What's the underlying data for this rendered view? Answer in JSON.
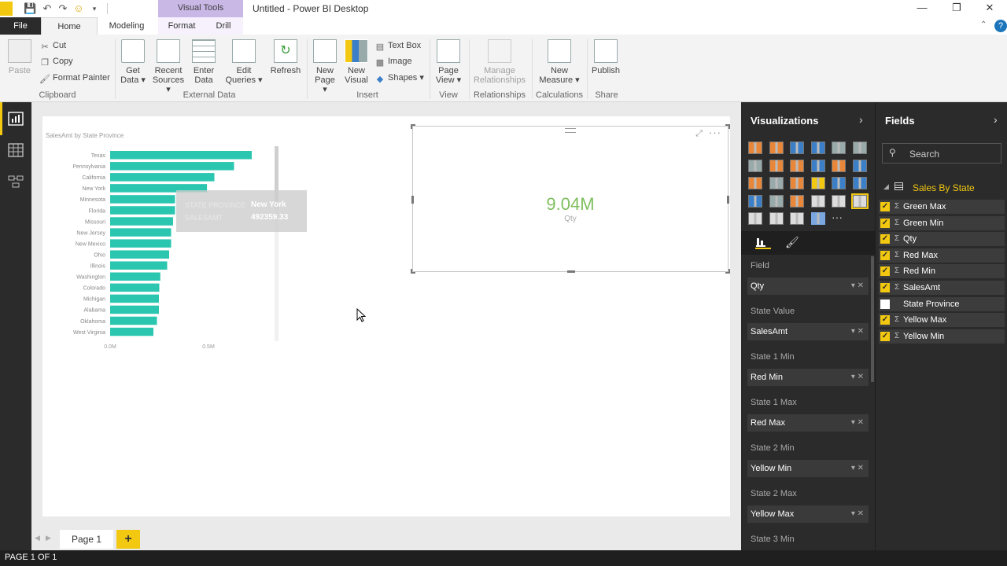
{
  "window": {
    "title": "Untitled - Power BI Desktop",
    "context_tab": "Visual Tools"
  },
  "tabs": [
    "File",
    "Home",
    "Modeling",
    "Format",
    "Drill"
  ],
  "ribbon": {
    "clipboard": {
      "paste": "Paste",
      "cut": "Cut",
      "copy": "Copy",
      "format_painter": "Format Painter",
      "label": "Clipboard"
    },
    "external_data": {
      "get_data": [
        "Get",
        "Data ▾"
      ],
      "recent_sources": [
        "Recent",
        "Sources ▾"
      ],
      "enter_data": [
        "Enter",
        "Data"
      ],
      "edit_queries": [
        "Edit",
        "Queries ▾"
      ],
      "refresh": "Refresh",
      "label": "External Data"
    },
    "insert": {
      "new_page": [
        "New",
        "Page ▾"
      ],
      "new_visual": [
        "New",
        "Visual"
      ],
      "text_box": "Text Box",
      "image": "Image",
      "shapes": "Shapes ▾",
      "label": "Insert"
    },
    "view": {
      "page_view": [
        "Page",
        "View ▾"
      ],
      "label": "View"
    },
    "relationships": {
      "manage": [
        "Manage",
        "Relationships"
      ],
      "label": "Relationships"
    },
    "calculations": {
      "new_measure": [
        "New",
        "Measure ▾"
      ],
      "label": "Calculations"
    },
    "share": {
      "publish": "Publish",
      "label": "Share"
    }
  },
  "report": {
    "bar_title": "SalesAmt by State Province",
    "card_value": "9.04M",
    "card_label": "Qty",
    "tooltip": {
      "k1": "STATE PROVINCE",
      "v1": "New York",
      "k2": "SALESAMT",
      "v2": "492359.33"
    }
  },
  "chart_data": {
    "type": "bar",
    "orientation": "horizontal",
    "title": "SalesAmt by State Province",
    "categories": [
      "Texas",
      "Pennsylvania",
      "California",
      "New York",
      "Minnesota",
      "Florida",
      "Missouri",
      "New Jersey",
      "New Mexico",
      "Ohio",
      "Illinois",
      "Washington",
      "Colorado",
      "Michigan",
      "Alabama",
      "Oklahoma",
      "West Virginia"
    ],
    "values": [
      720000,
      630000,
      530000,
      492359.33,
      330000,
      330000,
      320000,
      310000,
      310000,
      300000,
      290000,
      255000,
      250000,
      248000,
      248000,
      238000,
      220000
    ],
    "x_ticks": [
      "0.0M",
      "0.5M"
    ],
    "xlim": [
      0,
      1000000
    ],
    "color": "#2bc6b0"
  },
  "pages": {
    "tab": "Page 1",
    "add": "+"
  },
  "status": "PAGE 1 OF 1",
  "visualizations": {
    "title": "Visualizations",
    "wells": [
      {
        "label": "Field",
        "value": "Qty"
      },
      {
        "label": "State Value",
        "value": "SalesAmt"
      },
      {
        "label": "State 1 Min",
        "value": "Red Min"
      },
      {
        "label": "State 1 Max",
        "value": "Red Max"
      },
      {
        "label": "State 2 Min",
        "value": "Yellow Min"
      },
      {
        "label": "State 2 Max",
        "value": "Yellow Max"
      },
      {
        "label": "State 3 Min",
        "value": ""
      }
    ]
  },
  "fields": {
    "title": "Fields",
    "search_placeholder": "Search",
    "table": "Sales By State",
    "items": [
      {
        "name": "Green Max",
        "checked": true,
        "sigma": true
      },
      {
        "name": "Green Min",
        "checked": true,
        "sigma": true
      },
      {
        "name": "Qty",
        "checked": true,
        "sigma": true
      },
      {
        "name": "Red Max",
        "checked": true,
        "sigma": true
      },
      {
        "name": "Red Min",
        "checked": true,
        "sigma": true
      },
      {
        "name": "SalesAmt",
        "checked": true,
        "sigma": true
      },
      {
        "name": "State Province",
        "checked": false,
        "sigma": false
      },
      {
        "name": "Yellow Max",
        "checked": true,
        "sigma": true
      },
      {
        "name": "Yellow Min",
        "checked": true,
        "sigma": true
      }
    ]
  },
  "colors": {
    "accent": "#f2c811",
    "bar": "#2bc6b0",
    "card_value": "#7fbf5f",
    "file_tab": "#2b2b2b",
    "visual_tools": "#c9b7e6"
  }
}
